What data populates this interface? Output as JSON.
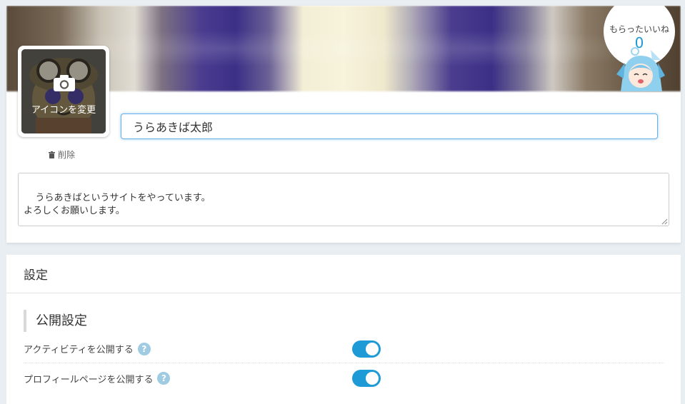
{
  "profile": {
    "likes_label": "もらったいいね",
    "likes_count": "0",
    "change_icon_label": "アイコンを変更",
    "delete_label": "削除",
    "name_value": "うらあきば太郎",
    "bio_text": "うらあきばというサイトをやっています。\nよろしくお願いします。"
  },
  "settings": {
    "title": "設定",
    "section_heading": "公開設定",
    "rows": [
      {
        "label": "アクティビティを公開する",
        "enabled": true
      },
      {
        "label": "プロフィールページを公開する",
        "enabled": true
      }
    ]
  },
  "icons": {
    "camera": "camera-icon",
    "trash": "trash-icon",
    "help": "question-icon",
    "resize": "resize-grip-icon"
  },
  "colors": {
    "accent": "#1e9ad6",
    "help_icon": "#9fcbe3",
    "input_focus": "#66afe9"
  }
}
